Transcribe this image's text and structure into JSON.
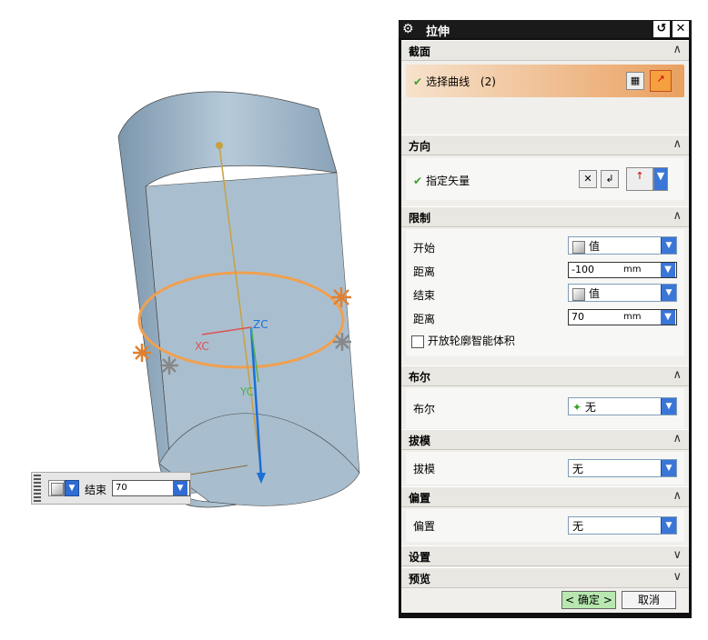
{
  "viewport": {
    "axis_labels": {
      "zc": "ZC",
      "xc": "XC",
      "yc": "YC"
    }
  },
  "minibar": {
    "label": "结束",
    "value": "70"
  },
  "dialog": {
    "title": "拉伸",
    "sections": {
      "section": {
        "title": "截面",
        "select_curve": "选择曲线",
        "curve_count": "(2)"
      },
      "direction": {
        "title": "方向",
        "specify_vector": "指定矢量"
      },
      "limits": {
        "title": "限制",
        "start_label": "开始",
        "start_value": "值",
        "start_distance_label": "距离",
        "start_distance": "-100",
        "end_label": "结束",
        "end_value": "值",
        "end_distance_label": "距离",
        "end_distance": "70",
        "unit": "mm",
        "open_profile_label": "开放轮廓智能体积"
      },
      "boolean": {
        "title": "布尔",
        "label": "布尔",
        "value": "无"
      },
      "draft": {
        "title": "拔模",
        "label": "拔模",
        "value": "无"
      },
      "offset": {
        "title": "偏置",
        "label": "偏置",
        "value": "无"
      },
      "settings": {
        "title": "设置"
      },
      "preview": {
        "title": "预览"
      }
    },
    "ok_label": "< 确定 >",
    "cancel_label": "取消"
  },
  "colors": {
    "cylinder": "#9fb6c8",
    "highlight": "#f0a050",
    "axis_blue": "#1a6ed8"
  }
}
